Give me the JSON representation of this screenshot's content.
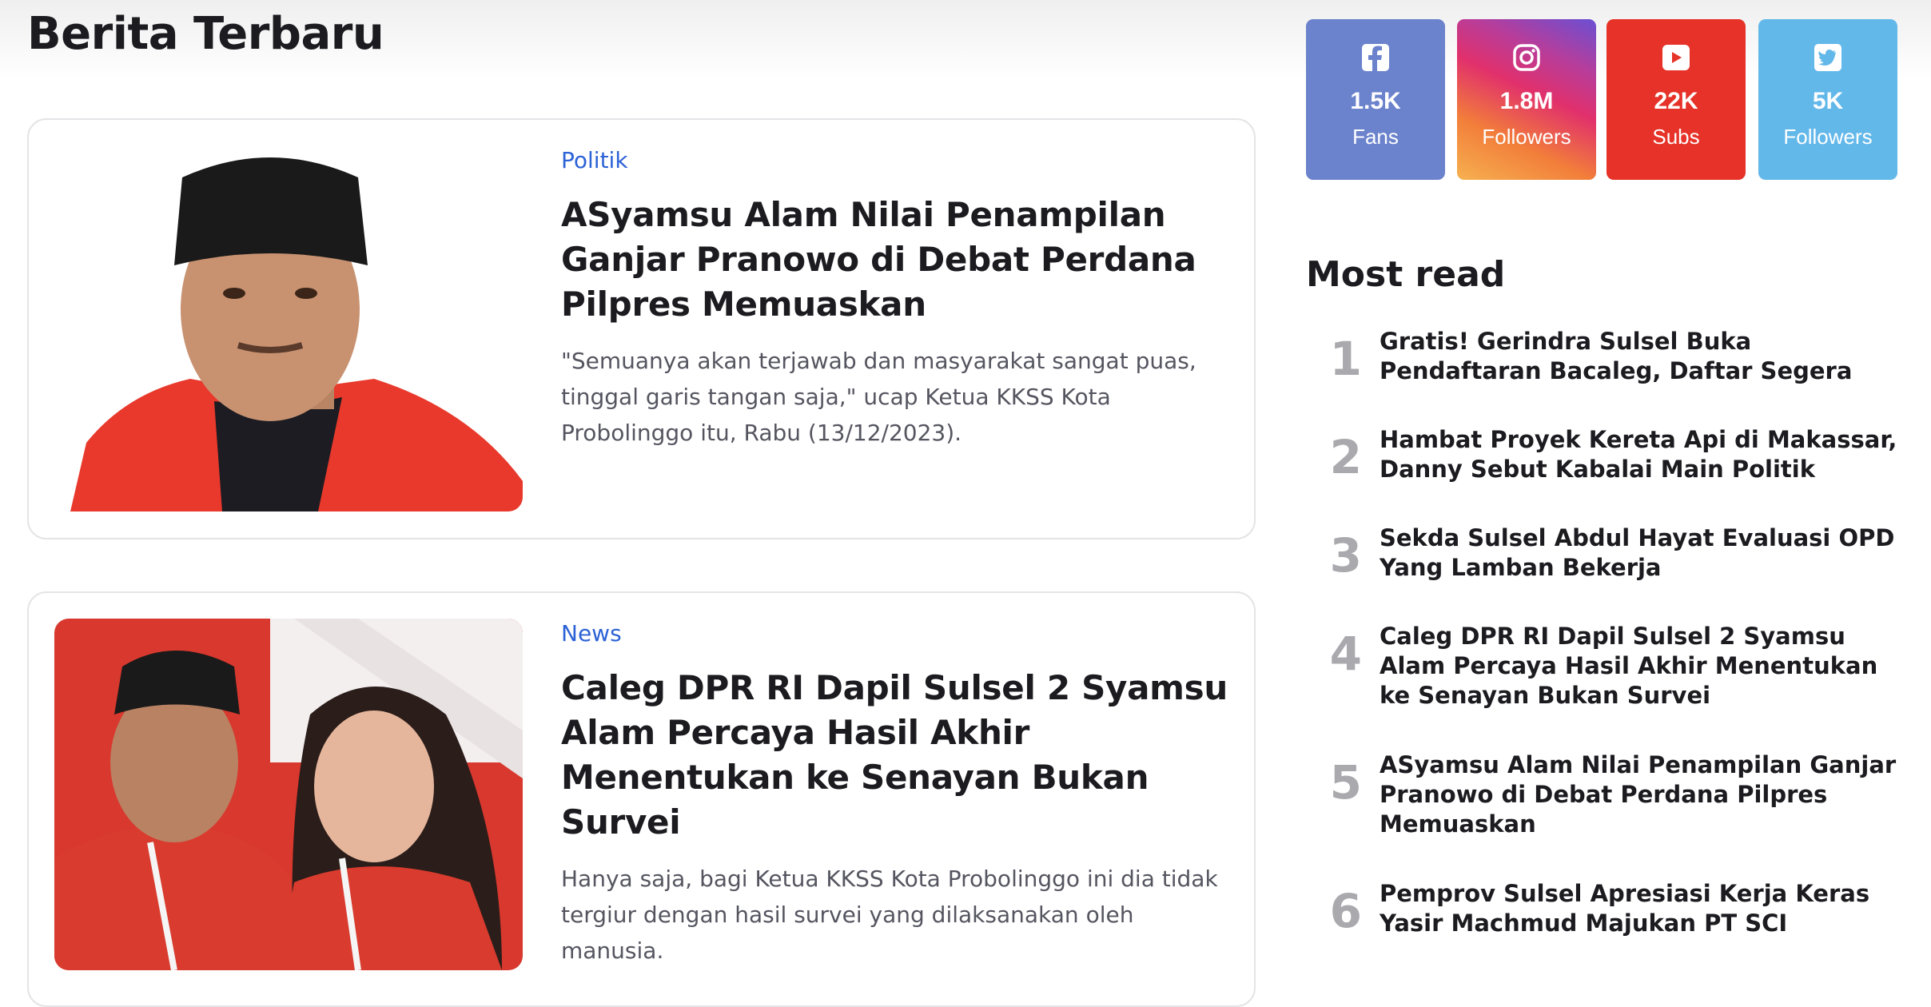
{
  "section": {
    "title": "Berita Terbaru"
  },
  "articles": [
    {
      "category": "Politik",
      "title": "ASyamsu Alam Nilai Penampilan Ganjar Pranowo di Debat Perdana Pilpres Memuaskan",
      "excerpt": "\"Semuanya akan terjawab dan masyarakat sangat puas, tinggal garis tangan saja,\" ucap Ketua KKSS Kota Probolinggo itu, Rabu (13/12/2023)."
    },
    {
      "category": "News",
      "title": "Caleg DPR RI Dapil Sulsel 2 Syamsu Alam Percaya Hasil Akhir Menentukan ke Senayan Bukan Survei",
      "excerpt": "Hanya saja, bagi Ketua KKSS Kota Probolinggo ini dia tidak tergiur dengan hasil survei yang dilaksanakan oleh manusia."
    }
  ],
  "social": [
    {
      "icon": "facebook-icon",
      "count": "1.5K",
      "label": "Fans",
      "color": "#6b82cc"
    },
    {
      "icon": "instagram-icon",
      "count": "1.8M",
      "label": "Followers",
      "color": "#e1306c"
    },
    {
      "icon": "youtube-icon",
      "count": "22K",
      "label": "Subs",
      "color": "#e63228"
    },
    {
      "icon": "twitter-icon",
      "count": "5K",
      "label": "Followers",
      "color": "#63b8ea"
    }
  ],
  "most_read": {
    "title": "Most read",
    "items": [
      {
        "rank": "1",
        "title": "Gratis! Gerindra Sulsel Buka Pendaftaran Bacaleg, Daftar Segera"
      },
      {
        "rank": "2",
        "title": "Hambat Proyek Kereta Api di Makassar, Danny Sebut Kabalai Main Politik"
      },
      {
        "rank": "3",
        "title": "Sekda Sulsel Abdul Hayat Evaluasi OPD Yang Lamban Bekerja"
      },
      {
        "rank": "4",
        "title": "Caleg DPR RI Dapil Sulsel 2 Syamsu Alam Percaya Hasil Akhir Menentukan ke Senayan Bukan Survei"
      },
      {
        "rank": "5",
        "title": "ASyamsu Alam Nilai Penampilan Ganjar Pranowo di Debat Perdana Pilpres Memuaskan"
      },
      {
        "rank": "6",
        "title": "Pemprov Sulsel Apresiasi Kerja Keras Yasir Machmud Majukan PT SCI"
      }
    ]
  },
  "colors": {
    "category": "#2d63d6",
    "rank": "#a9a9ae",
    "text": "#1b1b20"
  }
}
